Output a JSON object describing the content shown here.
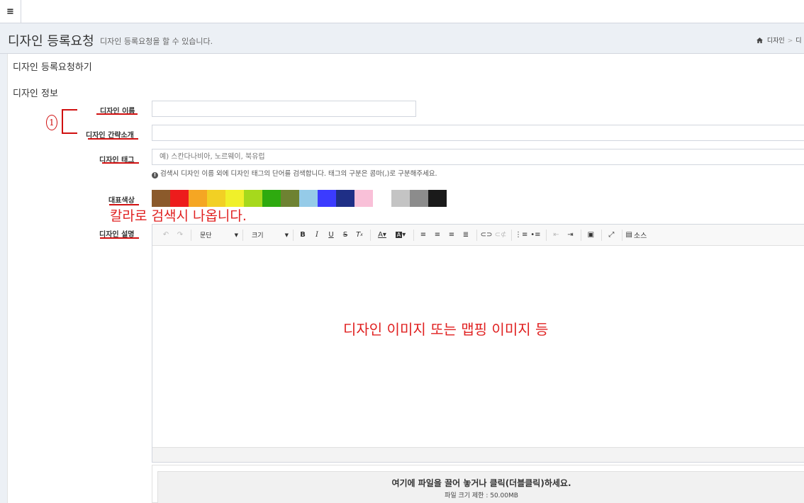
{
  "topbar": {
    "menu_icon": "hamburger-menu-icon",
    "menu_glyph": "≡"
  },
  "header": {
    "title": "디자인 등록요청",
    "subtitle": "디자인 등록요청을 할 수 있습니다.",
    "breadcrumb": {
      "home_icon": "home-icon",
      "item1": "디자인",
      "item2": "디"
    }
  },
  "box": {
    "title": "디자인 등록요청하기"
  },
  "section": {
    "title": "디자인 정보"
  },
  "fields": {
    "name_label": "디자인 이름",
    "name_value": "",
    "intro_label": "디자인 간략소개",
    "intro_value": "",
    "tag_label": "디자인 태그",
    "tag_placeholder": "예) 스칸다나비아, 노르웨이, 북유럽",
    "tag_help": "검색시 디자인 이름 외에 디자인 태그의 단어를 검색합니다. 태그의 구분은 콤마(,)로 구분해주세요.",
    "color_label": "대표색상",
    "desc_label": "디자인 설명"
  },
  "colors": [
    "#8b5a2b",
    "#ed1c1c",
    "#f5a623",
    "#f2d024",
    "#f0f02a",
    "#a6d91c",
    "#2eaa0f",
    "#6e8232",
    "#95cbe8",
    "#3b3bff",
    "#1f2f86",
    "#f9c0d8",
    "#ffffff",
    "#c4c4c4",
    "#8c8c8c",
    "#1a1a1a"
  ],
  "annotations": {
    "circle_number": "1",
    "color_note": "칼라로 검색시 나옵니다.",
    "editor_note": "디자인 이미지 또는 맵핑 이미지 등"
  },
  "editor": {
    "paragraph_label": "문단",
    "size_label": "크기",
    "source_label": "소스"
  },
  "dropzone": {
    "title": "여기에 파일을 끌어 놓거나 클릭(더블클릭)하세요.",
    "limit": "파일 크기 제한 : 50.00MB"
  },
  "accent": "#d01010"
}
